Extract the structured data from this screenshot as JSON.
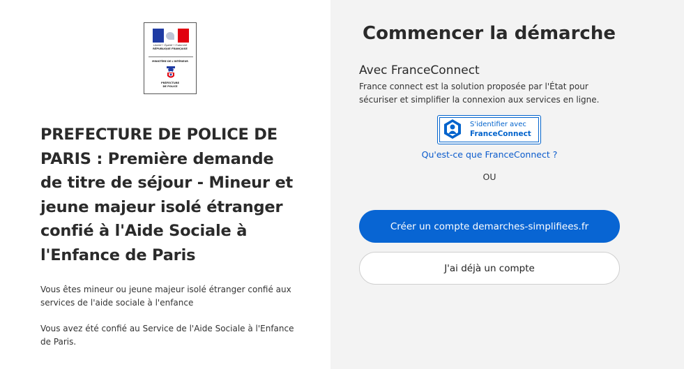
{
  "logo": {
    "motto": "Liberté • Égalité • Fraternité",
    "republic": "RÉPUBLIQUE FRANÇAISE",
    "ministry": "MINISTÈRE DE L'INTÉRIEUR",
    "prefecture_line1": "PRÉFECTURE",
    "prefecture_line2": "DE POLICE",
    "flag_colors": [
      "#1f3ba3",
      "#ffffff",
      "#e1000f"
    ]
  },
  "procedure": {
    "title": "PREFECTURE DE POLICE DE PARIS : Première demande de titre de séjour - Mineur et jeune majeur isolé étranger confié à l'Aide Sociale à l'Enfance de Paris",
    "description_1": "Vous êtes mineur ou jeune majeur isolé étranger confié aux services de l'aide sociale à l'enfance",
    "description_2": "Vous avez été confié au Service de l'Aide Sociale à l'Enfance de Paris."
  },
  "start": {
    "heading": "Commencer la démarche",
    "franceconnect_title": "Avec FranceConnect",
    "franceconnect_text": "France connect est la solution proposée par l'État pour sécuriser et simplifier la connexion aux services en ligne.",
    "fc_button_line1": "S'identifier avec",
    "fc_button_line2": "FranceConnect",
    "fc_link": "Qu'est-ce que FranceConnect ?",
    "or": "OU",
    "create_account": "Créer un compte demarches-simplifiees.fr",
    "existing_account": "J'ai déjà un compte"
  },
  "colors": {
    "accent": "#0865d3",
    "panel_bg": "#f3f3f3"
  }
}
